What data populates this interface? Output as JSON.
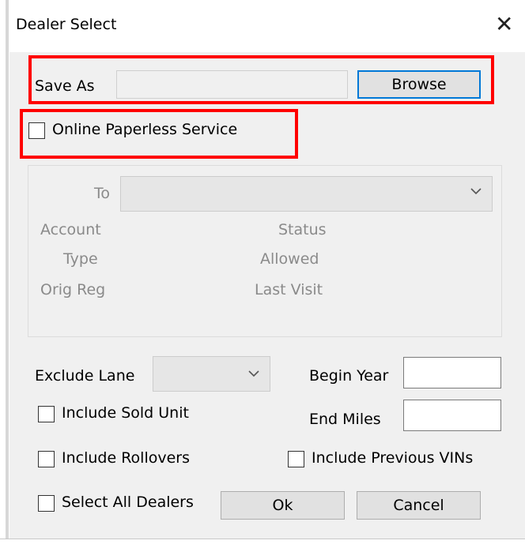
{
  "dialog": {
    "title": "Dealer Select",
    "close_glyph": "✕"
  },
  "save_as": {
    "label": "Save As",
    "value": "",
    "browse_label": "Browse"
  },
  "online_paperless": {
    "label": "Online Paperless Service",
    "checked": false
  },
  "details": {
    "to_label": "To",
    "account_label": "Account",
    "type_label": "Type",
    "orig_reg_label": "Orig Reg",
    "status_label": "Status",
    "allowed_label": "Allowed",
    "last_visit_label": "Last Visit"
  },
  "options": {
    "exclude_lane_label": "Exclude Lane",
    "exclude_lane_value": "",
    "begin_year_label": "Begin Year",
    "begin_year_value": "",
    "end_miles_label": "End Miles",
    "end_miles_value": "",
    "include_sold_unit_label": "Include Sold Unit",
    "include_rollovers_label": "Include Rollovers",
    "include_previous_vins_label": "Include Previous VINs",
    "select_all_dealers_label": "Select All Dealers"
  },
  "actions": {
    "ok_label": "Ok",
    "cancel_label": "Cancel"
  },
  "icons": {
    "close": "close-icon",
    "dropdown": "chevron-down-icon"
  },
  "colors": {
    "highlight": "#ff0000",
    "default_button_border": "#0078d7",
    "disabled_text": "#8a8a8a"
  }
}
